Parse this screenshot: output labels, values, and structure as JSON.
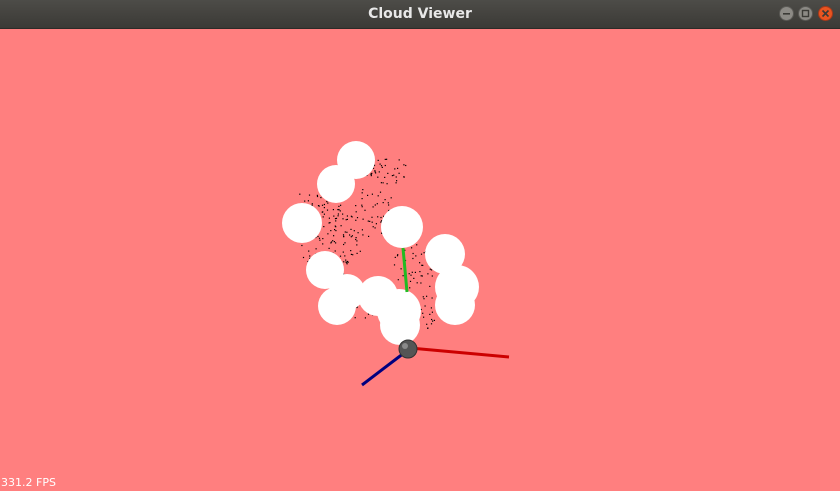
{
  "window": {
    "title": "Cloud Viewer"
  },
  "status": {
    "fps": "331.2 FPS"
  },
  "colors": {
    "background": "#ff7f7f",
    "point_cloud": "#000000",
    "sphere": "#ffffff",
    "axis_x": "#cc0000",
    "axis_y": "#22bb22",
    "axis_z": "#00007f"
  },
  "icons": {
    "minimize": "minimize-icon",
    "maximize": "maximize-icon",
    "close": "close-icon"
  }
}
